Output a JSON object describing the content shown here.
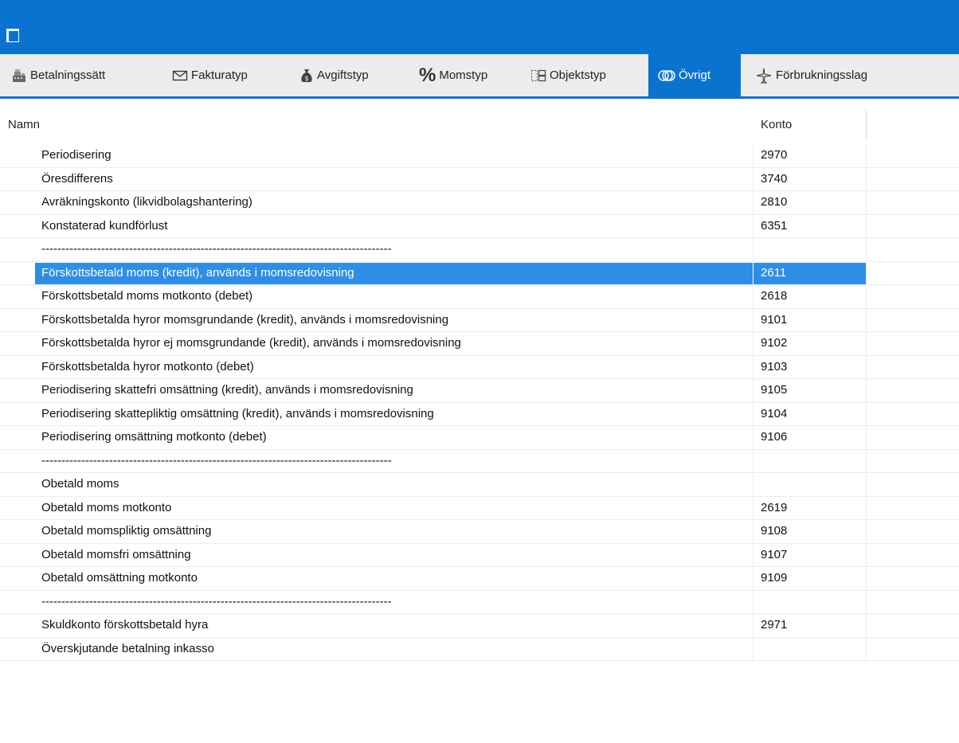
{
  "toolbar": {
    "tabs": [
      {
        "label": "Betalningssätt",
        "icon": "cash-register-icon"
      },
      {
        "label": "Fakturatyp",
        "icon": "envelope-icon"
      },
      {
        "label": "Avgiftstyp",
        "icon": "money-bag-icon"
      },
      {
        "label": "Momstyp",
        "icon": "percent-icon"
      },
      {
        "label": "Objektstyp",
        "icon": "object-type-icon"
      },
      {
        "label": "Övrigt",
        "icon": "rings-icon",
        "active": true
      },
      {
        "label": "Förbrukningsslag",
        "icon": "plane-icon"
      }
    ]
  },
  "grid": {
    "columns": [
      "Namn",
      "Konto"
    ],
    "rows": [
      {
        "name": "Periodisering",
        "konto": "2970"
      },
      {
        "name": "Öresdifferens",
        "konto": "3740"
      },
      {
        "name": "Avräkningskonto (likvidbolagshantering)",
        "konto": "2810"
      },
      {
        "name": "Konstaterad kundförlust",
        "konto": "6351"
      },
      {
        "name": "----------------------------------------------------------------------------------------",
        "konto": ""
      },
      {
        "name": "Förskottsbetald moms (kredit), används i momsredovisning",
        "konto": "2611",
        "selected": true
      },
      {
        "name": "Förskottsbetald moms motkonto (debet)",
        "konto": "2618"
      },
      {
        "name": "Förskottsbetalda hyror momsgrundande (kredit), används i momsredovisning",
        "konto": "9101"
      },
      {
        "name": "Förskottsbetalda hyror ej momsgrundande (kredit), används i momsredovisning",
        "konto": "9102"
      },
      {
        "name": "Förskottsbetalda hyror motkonto (debet)",
        "konto": "9103"
      },
      {
        "name": "Periodisering skattefri omsättning (kredit), används i momsredovisning",
        "konto": "9105"
      },
      {
        "name": "Periodisering skattepliktig omsättning (kredit), används i momsredovisning",
        "konto": "9104"
      },
      {
        "name": "Periodisering omsättning motkonto (debet)",
        "konto": "9106"
      },
      {
        "name": "----------------------------------------------------------------------------------------",
        "konto": ""
      },
      {
        "name": "Obetald moms",
        "konto": ""
      },
      {
        "name": "Obetald moms motkonto",
        "konto": "2619"
      },
      {
        "name": "Obetald momspliktig omsättning",
        "konto": "9108"
      },
      {
        "name": "Obetald momsfri omsättning",
        "konto": "9107"
      },
      {
        "name": "Obetald omsättning motkonto",
        "konto": "9109"
      },
      {
        "name": "----------------------------------------------------------------------------------------",
        "konto": ""
      },
      {
        "name": "Skuldkonto förskottsbetald hyra",
        "konto": "2971"
      },
      {
        "name": "Överskjutande betalning inkasso",
        "konto": ""
      }
    ]
  },
  "colors": {
    "accent": "#0a73cf",
    "selection": "#2e8ee6",
    "toolbar_bg": "#ececec"
  }
}
